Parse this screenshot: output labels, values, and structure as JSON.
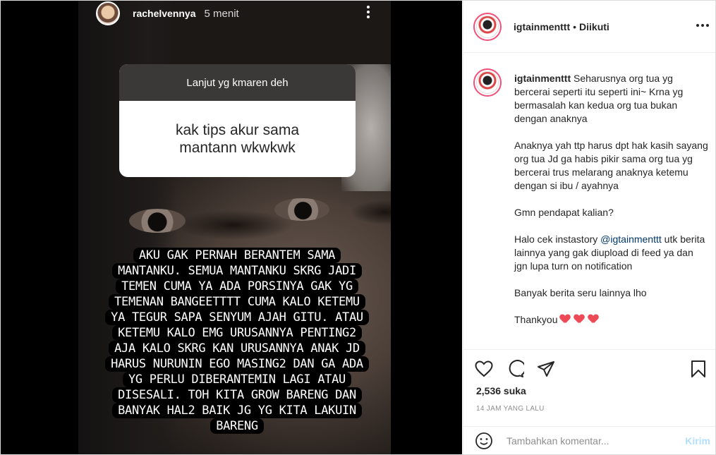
{
  "story": {
    "username": "rachelvennya",
    "time": "5 menit",
    "question_title": "Lanjut yg kmaren deh",
    "question_answer_line1": "kak tips akur sama",
    "question_answer_line2": "mantann wkwkwk",
    "overlay_lines": [
      "AKU GAK PERNAH BERANTEM SAMA",
      "MANTANKU. SEMUA MANTANKU SKRG JADI",
      "TEMEN CUMA YA ADA PORSINYA GAK YG",
      "TEMENAN BANGEETTTT CUMA KALO KETEMU",
      "YA TEGUR SAPA SENYUM AJAH GITU. ATAU",
      "KETEMU KALO EMG URUSANNYA PENTING2",
      "AJA KALO SKRG KAN URUSANNYA ANAK JD",
      "HARUS NURUNIN EGO MASING2 DAN GA ADA",
      "YG PERLU DIBERANTEMIN LAGI ATAU",
      "DISESALI. TOH KITA GROW BARENG DAN",
      "BANYAK HAL2 BAIK JG YG KITA LAKUIN",
      "BARENG"
    ]
  },
  "post": {
    "header": {
      "username": "igtainmenttt",
      "separator": "•",
      "follow_status": "Diikuti"
    },
    "caption": {
      "username": "igtainmenttt",
      "para1": "Seharusnya org tua yg bercerai seperti itu seperti ini~ Krna yg bermasalah kan kedua org tua bukan dengan anaknya",
      "para2": "Anaknya yah ttp harus dpt hak kasih sayang org tua Jd ga habis pikir sama org tua yg bercerai trus melarang anaknya ketemu dengan si ibu / ayahnya",
      "para3": "Gmn pendapat kalian?",
      "para4_prefix": "Halo cek instastory",
      "para4_mention": "@igtainmenttt",
      "para4_suffix": "utk berita lainnya yang gak diupload di feed ya dan jgn lupa turn on notification",
      "para5": "Banyak berita seru lainnya lho",
      "para6": "Thankyou"
    },
    "likes": "2,536 suka",
    "time_ago": "14 JAM YANG LALU",
    "comment": {
      "placeholder": "Tambahkan komentar...",
      "post_label": "Kirim"
    }
  },
  "icons": {
    "like": "heart-outline-icon",
    "comment": "comment-bubble-icon",
    "share": "paper-plane-icon",
    "save": "bookmark-icon",
    "emoji": "smiley-icon",
    "more": "more-dots-icon"
  },
  "colors": {
    "mention": "#00376b",
    "post_button_disabled": "#b2dffc",
    "heart_red": "#ed4956",
    "story_ring": "#f0507a"
  }
}
